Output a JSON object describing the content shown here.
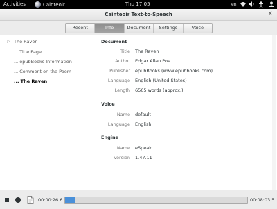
{
  "topbar": {
    "activities": "Activities",
    "app_name": "Cainteoir",
    "clock": "Thu 17:05",
    "keyboard_layout": "en",
    "tray_icons": [
      "network-icon",
      "volume-icon",
      "accessibility-icon",
      "user-icon"
    ]
  },
  "window": {
    "title": "Cainteoir Text-to-Speech",
    "close_glyph": "×"
  },
  "tabs": [
    {
      "label": "Recent",
      "active": false
    },
    {
      "label": "Info",
      "active": true
    },
    {
      "label": "Document",
      "active": false
    },
    {
      "label": "Settings",
      "active": false
    },
    {
      "label": "Voice",
      "active": false
    }
  ],
  "toc": {
    "root": "The Raven",
    "items": [
      {
        "label": "... Title Page"
      },
      {
        "label": "... epubBooks Information"
      },
      {
        "label": "... Comment on the Poem"
      },
      {
        "label": "... The Raven",
        "active": true
      }
    ]
  },
  "document": {
    "heading": "Document",
    "rows": [
      {
        "label": "Title",
        "value": "The Raven"
      },
      {
        "label": "Author",
        "value": "Edgar Allan Poe"
      },
      {
        "label": "Publisher",
        "value": "epubBooks (www.epubbooks.com)"
      },
      {
        "label": "Language",
        "value": "English (United States)"
      },
      {
        "label": "Length",
        "value": "6565 words (approx.)"
      }
    ]
  },
  "voice": {
    "heading": "Voice",
    "rows": [
      {
        "label": "Name",
        "value": "default"
      },
      {
        "label": "Language",
        "value": "English"
      }
    ]
  },
  "engine": {
    "heading": "Engine",
    "rows": [
      {
        "label": "Name",
        "value": "eSpeak"
      },
      {
        "label": "Version",
        "value": "1.47.11"
      }
    ]
  },
  "playback": {
    "elapsed": "00:00:26.6",
    "total": "00:08:03.5",
    "progress_fraction": 0.055,
    "accent_color": "#4a90d9"
  }
}
